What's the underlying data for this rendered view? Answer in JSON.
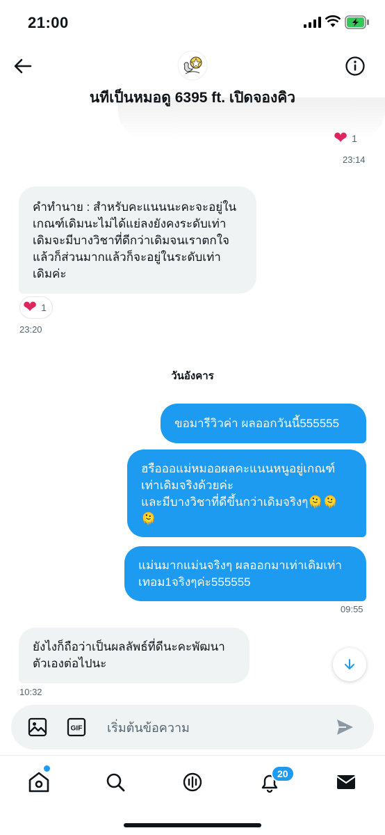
{
  "status": {
    "time": "21:00"
  },
  "header": {
    "title": "นทีเป็นหมอดู 6395 ft. เปิดจองคิว"
  },
  "messages": {
    "m1_reaction_count": "1",
    "m1_time": "23:14",
    "m2_text": "คำทำนาย : สำหรับคะแนนนะคะจะอยู่ใน\nเกณฑ์เดิมนะไม่ได้แย่ลงยังคงระดับเท่า\nเดิมจะมีบางวิชาที่ดีกว่าเดิมจนเราตกใจ\nแล้วก็ส่วนมากแล้วก็จะอยู่ในระดับเท่า\nเดิมค่ะ",
    "m2_reaction_count": "1",
    "m2_time": "23:20",
    "day_divider": "วันอังคาร",
    "out1_text": "ขอมารีวิวค่า ผลออกวันนี้555555",
    "out2_text": "ฮรือออแม่หมออผลคะแนนหนูอยู่เกณฑ์\nเท่าเดิมจริงด้วยค่ะ\nและมีบางวิชาที่ดีขึ้นกว่าเดิมจริงๆ🫠🫠\n🫠",
    "out3_text": "แม่นมากแม่นจริงๆ ผลออกมาเท่าเดิมเท่า\nเทอม1จริงๆค่ะ555555",
    "out_time": "09:55",
    "in_last_text": "ยังไงก็ถือว่าเป็นผลลัพธ์ที่ดีนะคะพัฒนา\nตัวเองต่อไปนะ",
    "in_last_time": "10:32"
  },
  "composer": {
    "placeholder": "เริ่มต้นข้อความ"
  },
  "nav": {
    "notifications_badge": "20"
  },
  "icons": [
    "back-arrow-icon",
    "info-icon",
    "heart-icon",
    "image-icon",
    "gif-icon",
    "send-icon",
    "home-icon",
    "search-icon",
    "spaces-icon",
    "bell-icon",
    "mail-icon",
    "chevron-down-icon"
  ],
  "colors": {
    "accent": "#1d9bf0",
    "bubble_in": "#eff3f4",
    "heart": "#e0245e"
  }
}
